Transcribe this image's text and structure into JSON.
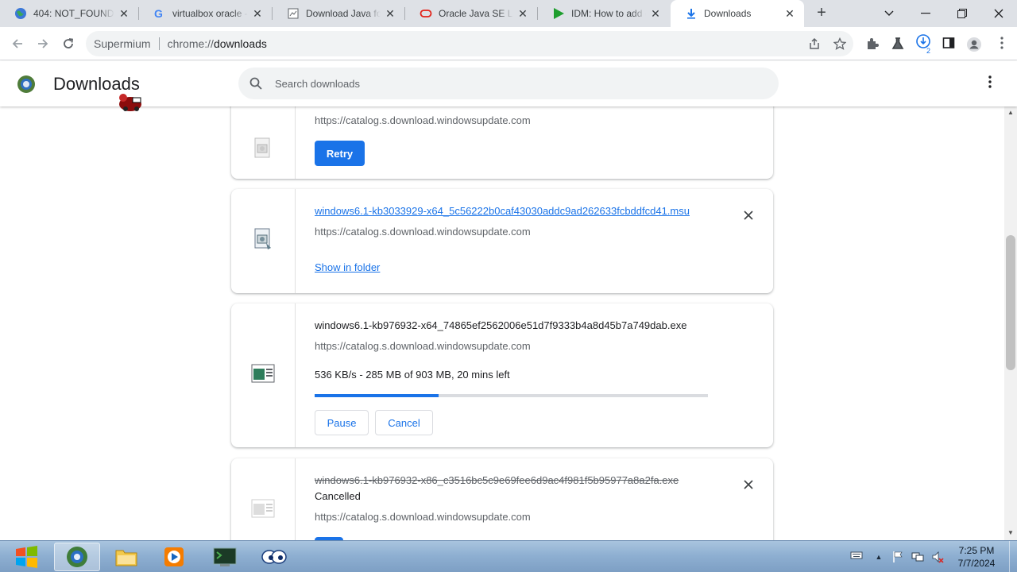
{
  "tabs": [
    {
      "label": "404: NOT_FOUND",
      "icon": "globe-icon"
    },
    {
      "label": "virtualbox oracle - Google Search",
      "icon": "google-icon"
    },
    {
      "label": "Download Java for Windows",
      "icon": "document-icon"
    },
    {
      "label": "Oracle Java SE License",
      "icon": "oracle-icon"
    },
    {
      "label": "IDM: How to add download",
      "icon": "idm-play-icon"
    },
    {
      "label": "Downloads",
      "icon": "download-icon"
    }
  ],
  "toolbar": {
    "brand": "Supermium",
    "url_scheme": "chrome://",
    "url_host": "downloads",
    "download_badge": "2"
  },
  "header": {
    "title": "Downloads",
    "search_placeholder": "Search downloads"
  },
  "downloads": [
    {
      "url": "https://catalog.s.download.windowsupdate.com",
      "action": "Retry"
    },
    {
      "file_name": "windows6.1-kb3033929-x64_5c56222b0caf43030addc9ad262633fcbddfcd41.msu",
      "url": "https://catalog.s.download.windowsupdate.com",
      "action": "Show in folder"
    },
    {
      "file_name": "windows6.1-kb976932-x64_74865ef2562006e51d7f9333b4a8d45b7a749dab.exe",
      "url": "https://catalog.s.download.windowsupdate.com",
      "status": "536 KB/s - 285 MB of 903 MB, 20 mins left",
      "progress": 0.316,
      "pause_label": "Pause",
      "cancel_label": "Cancel"
    },
    {
      "file_name": "windows6.1-kb976932-x86_c3516bc5c9e69fee6d9ac4f981f5b95977a8a2fa.exe",
      "status": "Cancelled",
      "url": "https://catalog.s.download.windowsupdate.com"
    }
  ],
  "taskbar": {
    "time": "7:25 PM",
    "date": "7/7/2024"
  },
  "colors": {
    "accent": "#1a73e8",
    "tabstrip": "#dee1e6",
    "omnibox": "#f1f3f4"
  }
}
